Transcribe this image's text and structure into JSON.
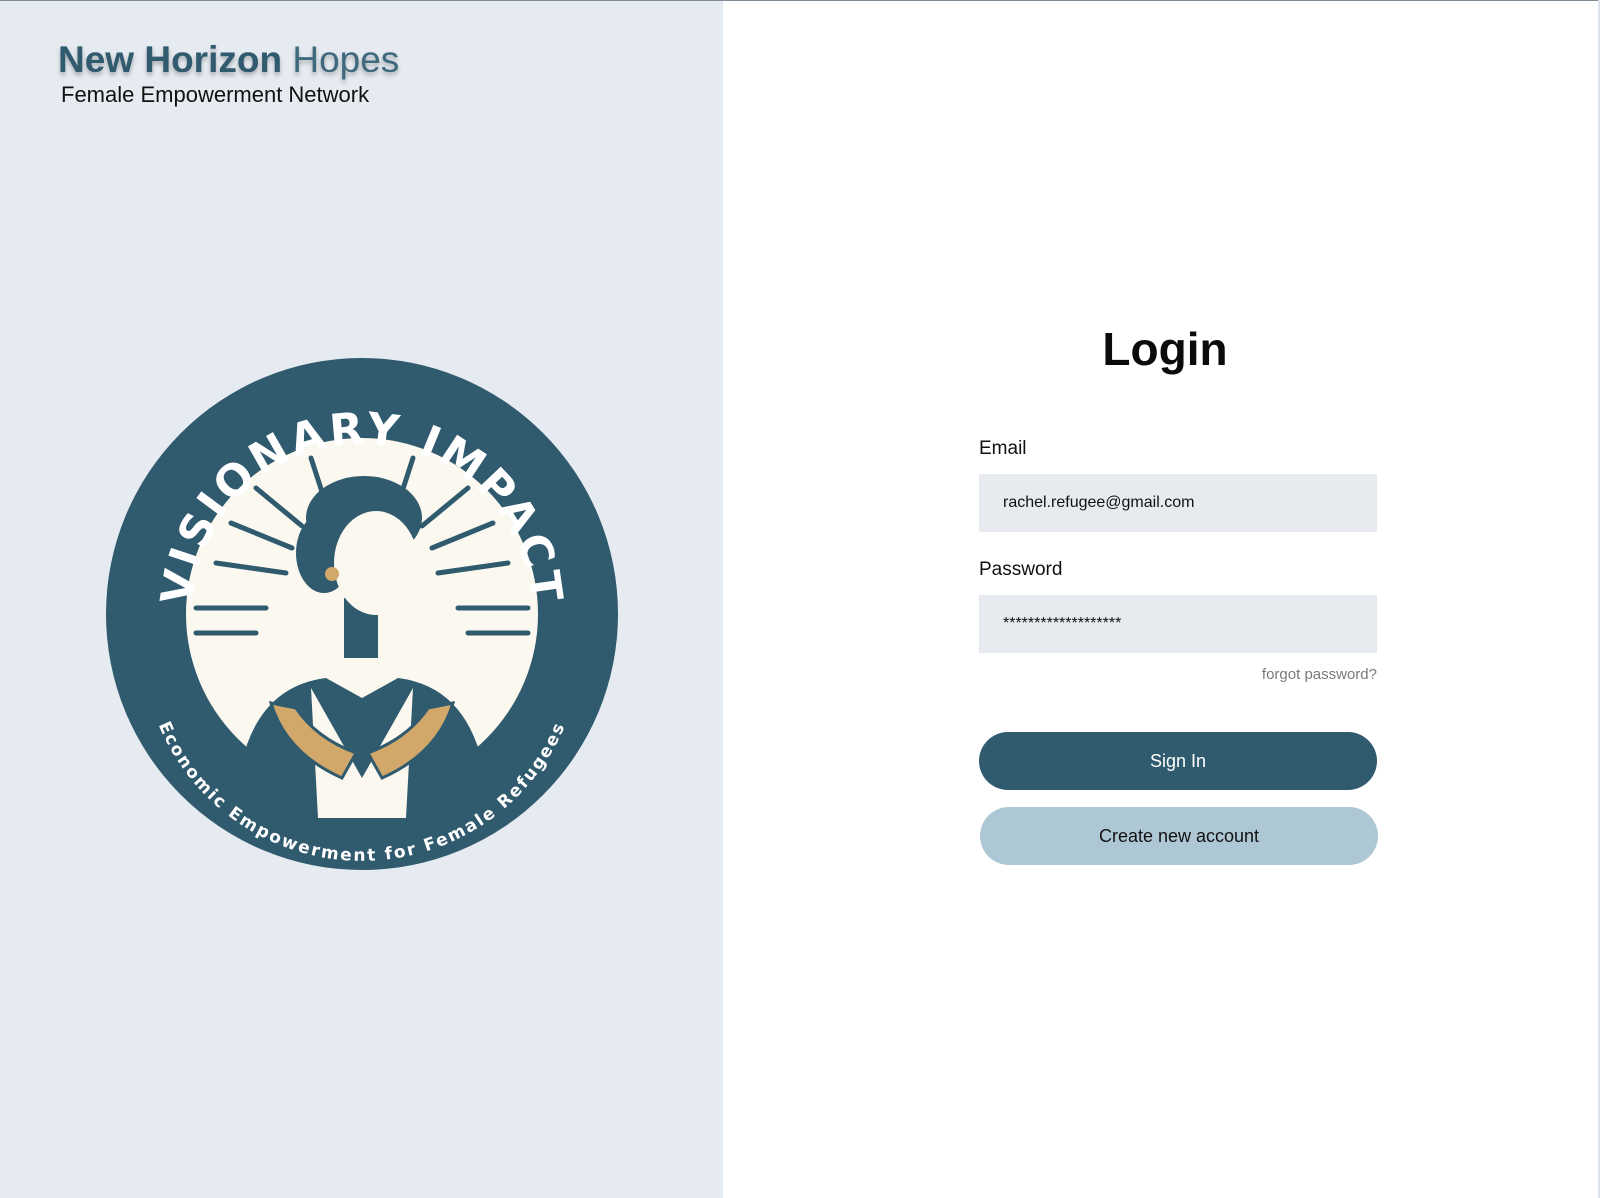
{
  "brand": {
    "name_bold": "New Horizon",
    "name_light": "Hopes",
    "tagline": "Female Empowerment Network"
  },
  "logo": {
    "top_text": "VISIONARY IMPACT",
    "bottom_text": "Economic Empowerment for Female Refugees",
    "colors": {
      "primary": "#305a6e",
      "cream": "#fbf8ef",
      "gold": "#d2a86a"
    }
  },
  "login": {
    "title": "Login",
    "email_label": "Email",
    "email_value": "rachel.refugee@gmail.com",
    "password_label": "Password",
    "password_value": "*******************",
    "forgot_link": "forgot password?",
    "sign_in_label": "Sign In",
    "create_account_label": "Create new account"
  },
  "colors": {
    "left_bg": "#e6ebf1",
    "right_bg": "#ffffff",
    "accent": "#305b6e",
    "secondary_button": "#aec7d5",
    "input_bg": "#e7ebf0"
  }
}
